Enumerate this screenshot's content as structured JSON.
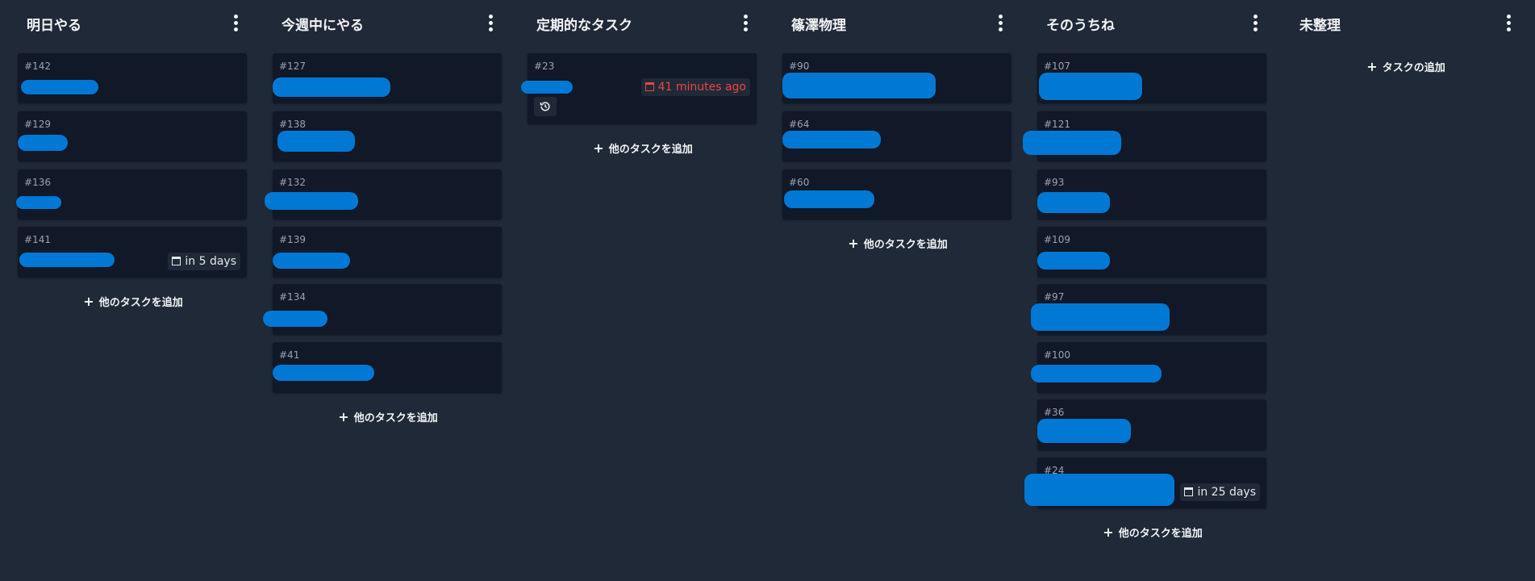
{
  "columns": [
    {
      "title": "明日やる",
      "add_label": "他のタスクを追加",
      "cards": [
        {
          "id": "#142"
        },
        {
          "id": "#129"
        },
        {
          "id": "#136"
        },
        {
          "id": "#141",
          "due": "in 5 days"
        }
      ]
    },
    {
      "title": "今週中にやる",
      "add_label": "他のタスクを追加",
      "cards": [
        {
          "id": "#127"
        },
        {
          "id": "#138"
        },
        {
          "id": "#132"
        },
        {
          "id": "#139"
        },
        {
          "id": "#134"
        },
        {
          "id": "#41"
        }
      ]
    },
    {
      "title": "定期的なタスク",
      "add_label": "他のタスクを追加",
      "cards": [
        {
          "id": "#23",
          "due": "41 minutes ago",
          "overdue": true,
          "repeating": true
        }
      ]
    },
    {
      "title": "篠澤物理",
      "add_label": "他のタスクを追加",
      "cards": [
        {
          "id": "#90"
        },
        {
          "id": "#64"
        },
        {
          "id": "#60"
        }
      ]
    },
    {
      "title": "そのうちね",
      "add_label": "他のタスクを追加",
      "cards": [
        {
          "id": "#107"
        },
        {
          "id": "#121"
        },
        {
          "id": "#93"
        },
        {
          "id": "#109"
        },
        {
          "id": "#97"
        },
        {
          "id": "#100"
        },
        {
          "id": "#36"
        },
        {
          "id": "#24",
          "due": "in 25 days"
        }
      ]
    },
    {
      "title": "未整理",
      "add_label": "タスクの追加",
      "cards": []
    }
  ],
  "colors": {
    "background": "#1f2937",
    "card": "#111827",
    "redaction": "#0078d4",
    "overdue": "#ef4444"
  },
  "icons": {
    "column_menu": "kebab-menu-icon",
    "due_date": "calendar-icon",
    "repeat": "history-icon",
    "add": "plus-icon"
  }
}
